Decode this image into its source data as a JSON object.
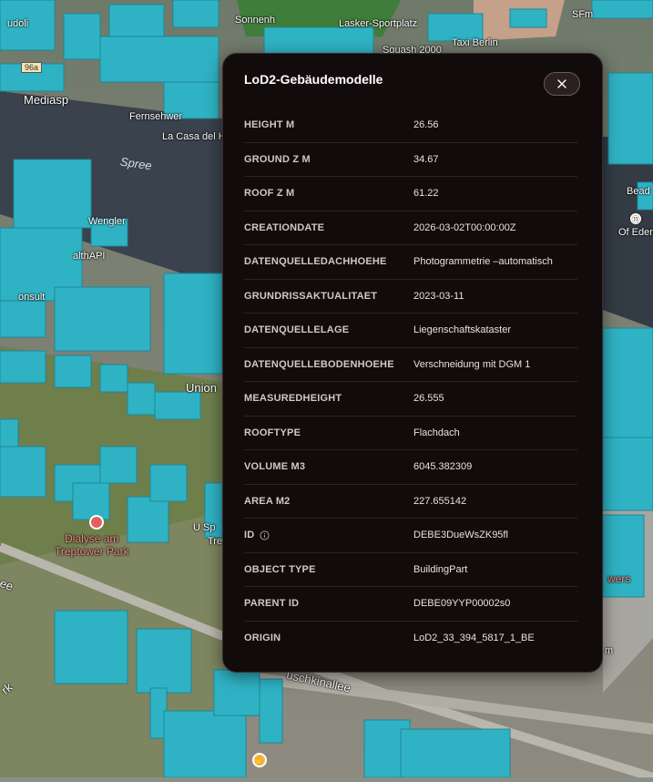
{
  "map": {
    "labels": {
      "sonnenhof": "Sonnenh",
      "lasker": "Lasker-Sportplatz",
      "sfm": "SFm",
      "audoli": "udoli",
      "squash": "Squash 2000",
      "taxi": "Taxi Berlin",
      "b96a": "96a",
      "mediasp": "Mediasp",
      "fernsehwerk": "Fernsehwer",
      "lacasa": "La Casa del Hab",
      "spree": "Spree",
      "wengler": "Wengler",
      "healthapi": "althAPI",
      "consult": "onsult",
      "union": "Union",
      "dialyse": "Dialyse am\nTreptower Park",
      "usp": "U Sp",
      "tre": "Tre",
      "bead": "Bead",
      "ofeden": "Of Eden",
      "ee": "ee",
      "rk": "rk",
      "puschkinallee": "uschkinallee",
      "wers": "wers",
      "m": "m",
      "b_top": "B",
      "u_top": "U"
    }
  },
  "panel": {
    "title": "LoD2-Gebäudemodelle",
    "close_icon": "close-icon",
    "rows": [
      {
        "key": "HEIGHT M",
        "value": "26.56"
      },
      {
        "key": "GROUND Z M",
        "value": "34.67"
      },
      {
        "key": "ROOF Z M",
        "value": "61.22"
      },
      {
        "key": "CREATIONDATE",
        "value": "2026-03-02T00:00:00Z"
      },
      {
        "key": "DATENQUELLEDACHHOEHE",
        "value": "Photogrammetrie –automatisch"
      },
      {
        "key": "GRUNDRISSAKTUALITAET",
        "value": "2023-03-11"
      },
      {
        "key": "DATENQUELLELAGE",
        "value": "Liegenschaftskataster"
      },
      {
        "key": "DATENQUELLEBODENHOEHE",
        "value": "Verschneidung mit DGM 1"
      },
      {
        "key": "MEASUREDHEIGHT",
        "value": "26.555"
      },
      {
        "key": "ROOFTYPE",
        "value": "Flachdach"
      },
      {
        "key": "VOLUME M3",
        "value": "6045.382309"
      },
      {
        "key": "AREA M2",
        "value": "227.655142"
      },
      {
        "key": "ID",
        "value": "DEBE3DueWsZK95fl",
        "info_icon": "info-icon"
      },
      {
        "key": "OBJECT TYPE",
        "value": "BuildingPart"
      },
      {
        "key": "PARENT ID",
        "value": "DEBE09YYP00002s0"
      },
      {
        "key": "ORIGIN",
        "value": "LoD2_33_394_5817_1_BE"
      }
    ]
  },
  "colors": {
    "building": "#2fb3c4",
    "building_dark": "#1f8797",
    "panel_bg": "#120b0c",
    "river": "#39424d"
  }
}
